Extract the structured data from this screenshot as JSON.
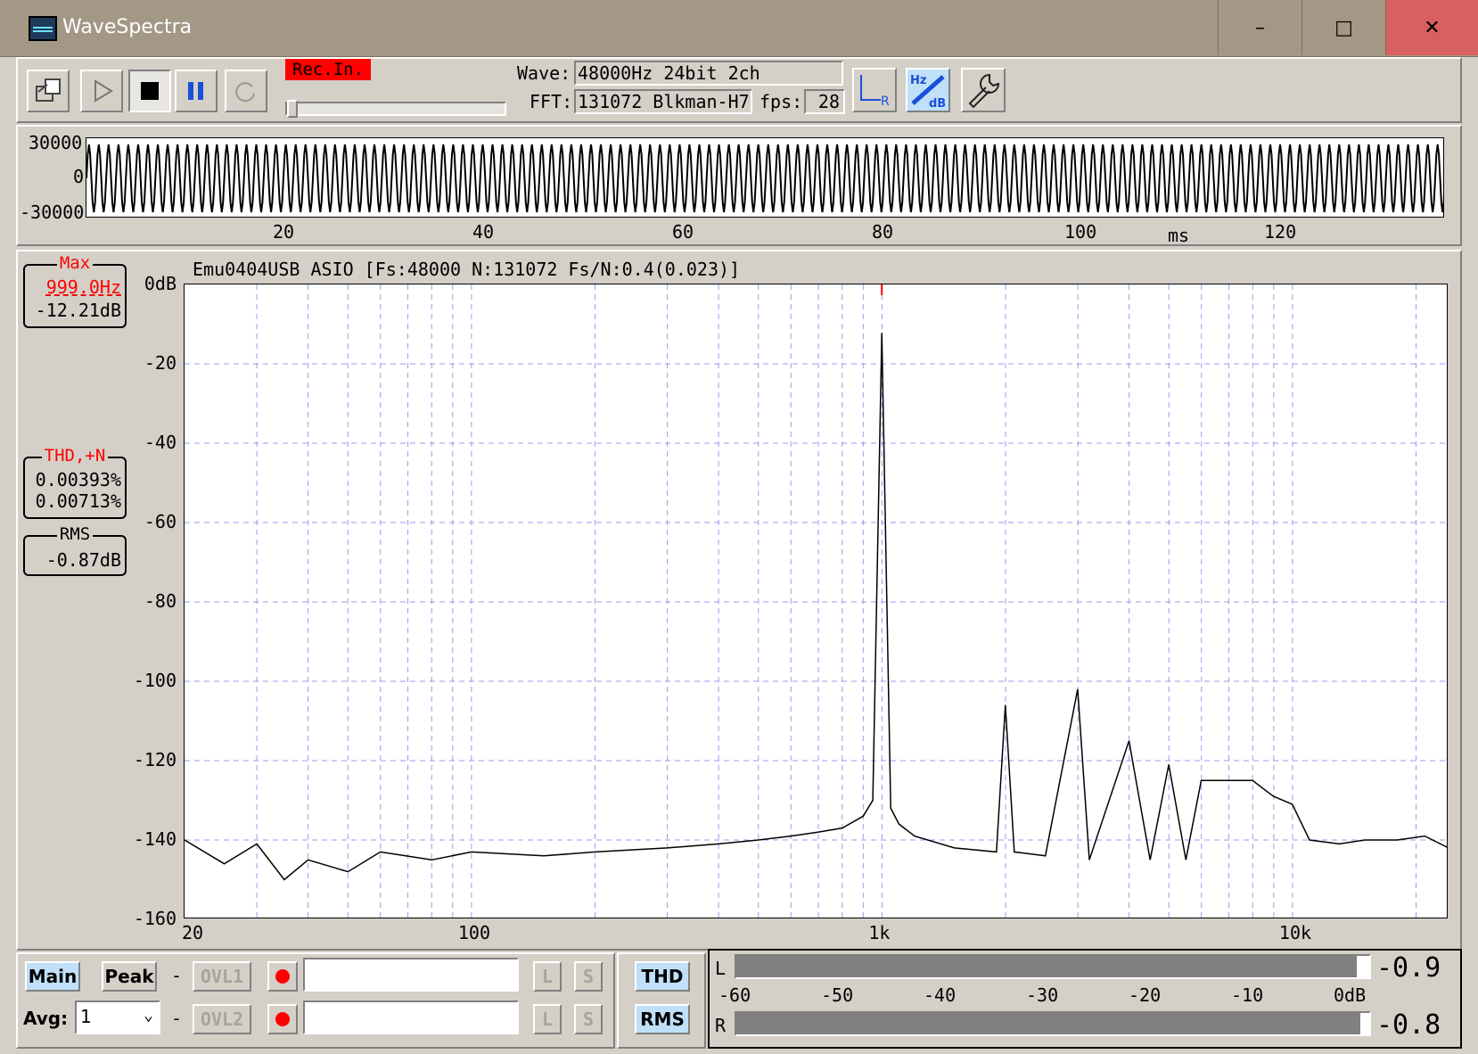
{
  "window": {
    "title": "WaveSpectra",
    "minimize": "–",
    "maximize": "□",
    "close": "✕"
  },
  "toolbar": {
    "rec_in": "Rec.In.",
    "wave_label": "Wave:",
    "wave_value": "48000Hz 24bit 2ch",
    "fft_label": "FFT:",
    "fft_value": "131072 Blkman-H7",
    "fps_label": "fps:",
    "fps_value": "28",
    "buttons": [
      "export-icon",
      "play-icon",
      "stop-icon",
      "pause-icon",
      "loop-icon",
      "lr-icon",
      "hz-db-icon",
      "settings-icon"
    ]
  },
  "waveform": {
    "y_ticks": [
      "30000",
      "0",
      "-30000"
    ],
    "x_ticks": [
      "20",
      "40",
      "60",
      "80",
      "100",
      "120"
    ],
    "x_unit": "ms"
  },
  "spectrum": {
    "header": "Emu0404USB ASIO  [Fs:48000 N:131072 Fs/N:0.4(0.023)]",
    "y_ticks": [
      "0dB",
      "-20",
      "-40",
      "-60",
      "-80",
      "-100",
      "-120",
      "-140",
      "-160"
    ],
    "x_ticks": [
      "20",
      "100",
      "1k",
      "10k"
    ]
  },
  "readouts": {
    "max_title": "Max",
    "max_freq": "999.0Hz",
    "max_db": "-12.21dB",
    "thd_title": "THD,+N",
    "thd": "0.00393%",
    "thdn": "0.00713%",
    "rms_title": "RMS",
    "rms": "-0.87dB"
  },
  "status": {
    "main": "Main",
    "peak": "Peak",
    "ovl1": "OVL1",
    "ovl2": "OVL2",
    "avg_label": "Avg:",
    "avg_value": "1",
    "dash": "-",
    "l": "L",
    "s": "S",
    "thd": "THD",
    "rms": "RMS"
  },
  "meter": {
    "l_label": "L",
    "r_label": "R",
    "l_value": "-0.9",
    "r_value": "-0.8",
    "scale": [
      "-60",
      "-50",
      "-40",
      "-30",
      "-20",
      "-10",
      "0dB"
    ]
  },
  "chart_data": {
    "type": "line",
    "title": "",
    "xlabel": "",
    "ylabel": "",
    "x_scale": "log",
    "xlim": [
      20,
      24000
    ],
    "ylim": [
      -160,
      0
    ],
    "grid": true,
    "series": [
      {
        "x": [
          20,
          25,
          30,
          35,
          40,
          50,
          60,
          80,
          100,
          150,
          200,
          300,
          400,
          500,
          600,
          700,
          800,
          900,
          950,
          999,
          1050,
          1100,
          1200,
          1500,
          1900,
          1998,
          2100,
          2500,
          2997,
          3200,
          3996,
          4500,
          4995,
          5500,
          5994,
          6993,
          7992,
          8991,
          9990,
          11000,
          13000,
          15000,
          18000,
          21000,
          24000
        ],
        "y": [
          -140,
          -146,
          -141,
          -150,
          -145,
          -148,
          -143,
          -145,
          -143,
          -144,
          -143,
          -142,
          -141,
          -140,
          -139,
          -138,
          -137,
          -134,
          -130,
          -12.21,
          -132,
          -136,
          -139,
          -142,
          -143,
          -106,
          -143,
          -144,
          -102,
          -145,
          -115,
          -145,
          -121,
          -145,
          -125,
          -125,
          -125,
          -129,
          -131,
          -140,
          -141,
          -140,
          -140,
          -139,
          -142
        ]
      }
    ]
  }
}
